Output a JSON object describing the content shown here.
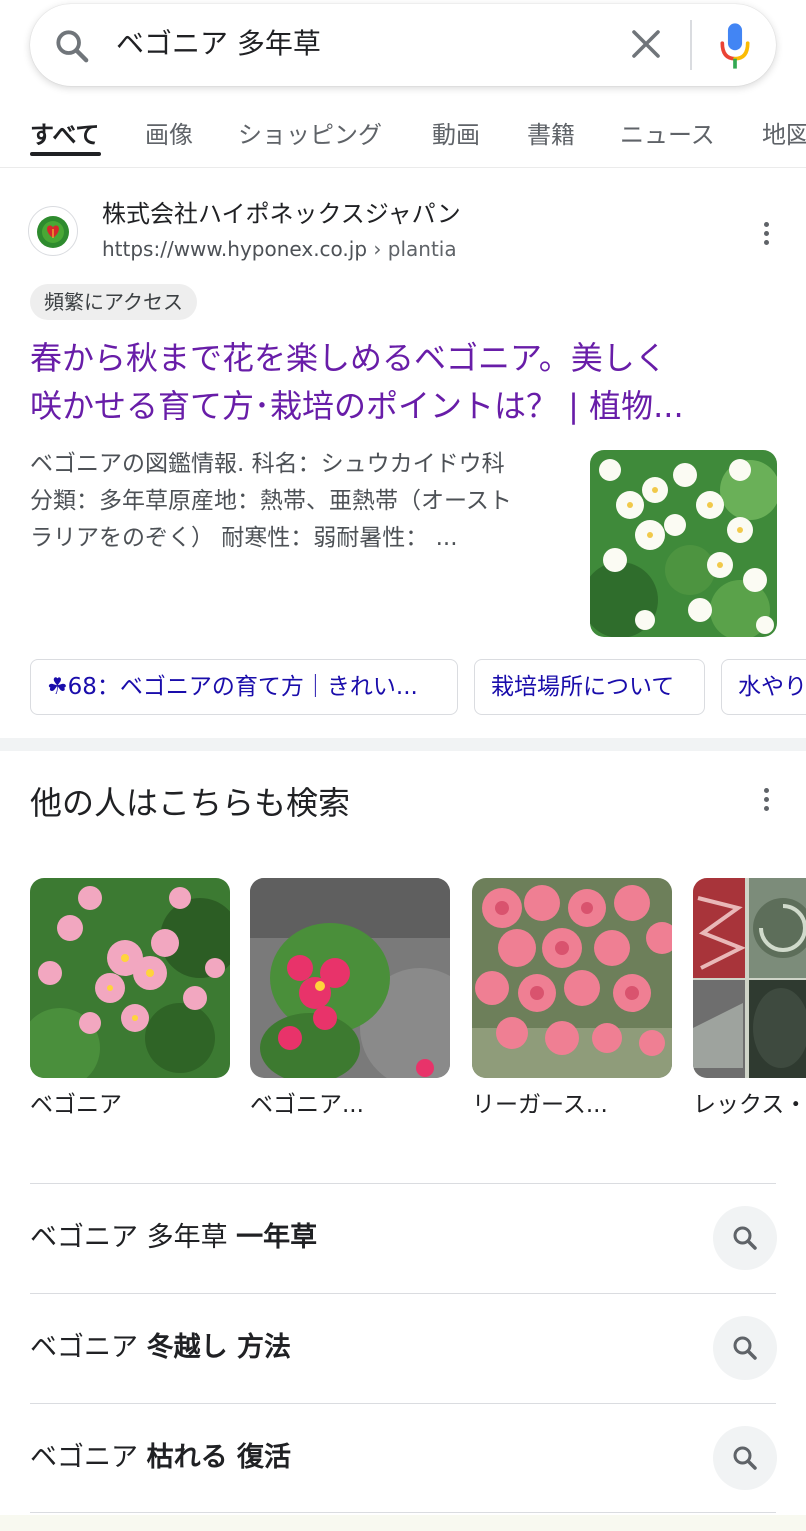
{
  "search": {
    "query": "ベゴニア 多年草"
  },
  "tabs": [
    {
      "label": "すべて",
      "active": true
    },
    {
      "label": "画像"
    },
    {
      "label": "ショッピング"
    },
    {
      "label": "動画"
    },
    {
      "label": "書籍"
    },
    {
      "label": "ニュース"
    },
    {
      "label": "地図"
    }
  ],
  "result": {
    "site_name": "株式会社ハイポネックスジャパン",
    "url": "https://www.hyponex.co.jp",
    "breadcrumb": "› plantia",
    "badge": "頻繁にアクセス",
    "title_line1": "春から秋まで花を楽しめるベゴニア。美しく",
    "title_line2": "咲かせる育て方･栽培のポイントは？ | 植物...",
    "snippet_line1": "ベゴニアの図鑑情報. 科名：シュウカイドウ科",
    "snippet_line2": "分類：多年草原産地：熱帯、亜熱帯（オースト",
    "snippet_line3": "ラリアをのぞく） 耐寒性：弱耐暑性： ...",
    "chips": [
      "☘68：ベゴニアの育て方｜きれい...",
      "栽培場所について",
      "水やり"
    ]
  },
  "related": {
    "heading": "他の人はこちらも検索",
    "images": [
      {
        "label": "ベゴニア"
      },
      {
        "label": "ベゴニア..."
      },
      {
        "label": "リーガース..."
      },
      {
        "label": "レックス・"
      }
    ]
  },
  "suggestions": [
    {
      "plain": "ベゴニア 多年草 ",
      "bold": "一年草"
    },
    {
      "plain": "ベゴニア ",
      "bold": "冬越し 方法"
    },
    {
      "plain": "ベゴニア ",
      "bold": "枯れる 復活"
    }
  ],
  "colors": {
    "visited_title": "#681da8",
    "link": "#1a0dab",
    "mic_blue": "#4285f4",
    "mic_red": "#ea4335",
    "mic_yellow": "#fbbc04",
    "mic_green": "#34a853"
  },
  "icons": [
    "search-icon",
    "clear-icon",
    "mic-icon",
    "site-favicon",
    "more-vert-icon",
    "suggestion-search-icon"
  ]
}
